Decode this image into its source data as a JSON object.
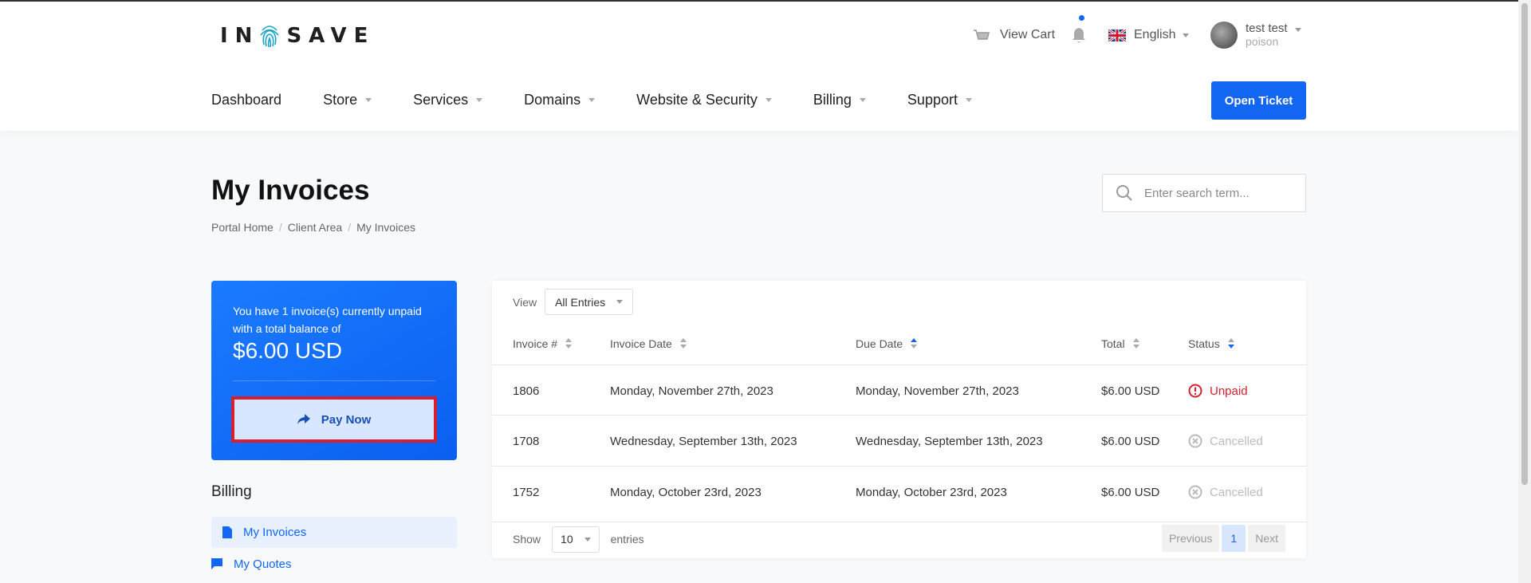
{
  "brand": {
    "logo_left": "IN",
    "logo_right": "SAVE"
  },
  "topbar": {
    "cart_label": "View Cart",
    "language": "English",
    "user_name": "test test",
    "user_sub": "poison"
  },
  "nav": {
    "items": [
      {
        "label": "Dashboard",
        "dropdown": false
      },
      {
        "label": "Store",
        "dropdown": true
      },
      {
        "label": "Services",
        "dropdown": true
      },
      {
        "label": "Domains",
        "dropdown": true
      },
      {
        "label": "Website & Security",
        "dropdown": true
      },
      {
        "label": "Billing",
        "dropdown": true
      },
      {
        "label": "Support",
        "dropdown": true
      }
    ],
    "open_ticket": "Open Ticket"
  },
  "page": {
    "title": "My Invoices",
    "breadcrumb": [
      "Portal Home",
      "Client Area",
      "My Invoices"
    ],
    "search_placeholder": "Enter search term..."
  },
  "balance": {
    "message": "You have 1 invoice(s) currently unpaid with a total balance of",
    "amount": "$6.00 USD",
    "pay_label": "Pay Now"
  },
  "sidebar": {
    "heading": "Billing",
    "items": [
      {
        "label": "My Invoices",
        "active": true,
        "icon": "document-icon"
      },
      {
        "label": "My Quotes",
        "active": false,
        "icon": "chat-icon"
      }
    ]
  },
  "table": {
    "view_label": "View",
    "view_value": "All Entries",
    "columns": [
      "Invoice #",
      "Invoice Date",
      "Due Date",
      "Total",
      "Status"
    ],
    "rows": [
      {
        "id": "1806",
        "date": "Monday, November 27th, 2023",
        "due": "Monday, November 27th, 2023",
        "total": "$6.00 USD",
        "status": "Unpaid"
      },
      {
        "id": "1708",
        "date": "Wednesday, September 13th, 2023",
        "due": "Wednesday, September 13th, 2023",
        "total": "$6.00 USD",
        "status": "Cancelled"
      },
      {
        "id": "1752",
        "date": "Monday, October 23rd, 2023",
        "due": "Monday, October 23rd, 2023",
        "total": "$6.00 USD",
        "status": "Cancelled"
      }
    ],
    "show_label": "Show",
    "show_value": "10",
    "entries_label": "entries",
    "pager": {
      "prev": "Previous",
      "current": "1",
      "next": "Next"
    }
  },
  "colors": {
    "accent": "#1266f1",
    "danger": "#d6202f"
  }
}
